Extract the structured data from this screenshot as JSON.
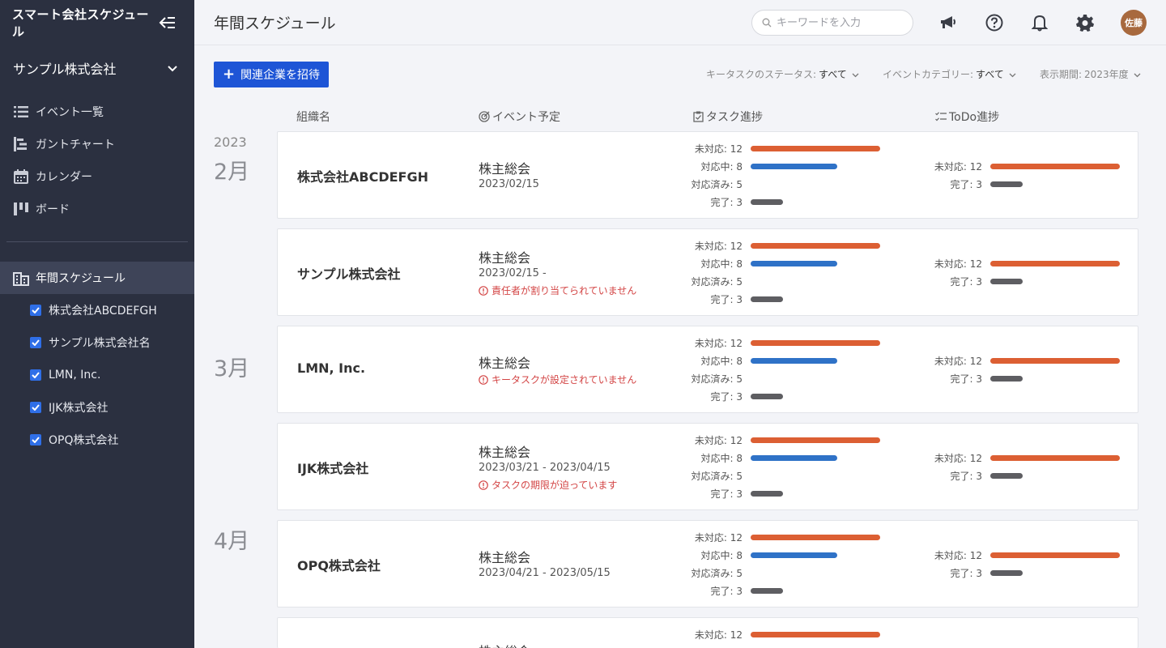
{
  "app": {
    "brand": "スマート会社スケジュール"
  },
  "sidebar": {
    "org_selector": "サンプル株式会社",
    "nav": [
      {
        "label": "イベント一覧",
        "icon": "list-icon"
      },
      {
        "label": "ガントチャート",
        "icon": "gantt-icon"
      },
      {
        "label": "カレンダー",
        "icon": "calendar-icon"
      },
      {
        "label": "ボード",
        "icon": "board-icon"
      }
    ],
    "active_section": {
      "label": "年間スケジュール",
      "icon": "building-icon"
    },
    "orgs": [
      {
        "label": "株式会社ABCDEFGH",
        "checked": true
      },
      {
        "label": "サンプル株式会社名",
        "checked": true
      },
      {
        "label": "LMN, Inc.",
        "checked": true
      },
      {
        "label": "IJK株式会社",
        "checked": true
      },
      {
        "label": "OPQ株式会社",
        "checked": true
      }
    ]
  },
  "header": {
    "title": "年間スケジュール",
    "search_placeholder": "キーワードを入力",
    "avatar": "佐藤"
  },
  "toolbar": {
    "invite_label": "関連企業を招待",
    "filters": [
      {
        "label": "キータスクのステータス:",
        "value": "すべて"
      },
      {
        "label": "イベントカテゴリー:",
        "value": "すべて"
      },
      {
        "label": "表示期間:",
        "value": "2023年度"
      }
    ]
  },
  "columns": {
    "org": "組織名",
    "event": "イベント予定",
    "task": "タスク進捗",
    "todo": "ToDo進捗"
  },
  "timeline": {
    "year": "2023",
    "months": [
      "2月",
      "3月",
      "4月"
    ]
  },
  "colors": {
    "orange": "#dc5f33",
    "blue": "#2f72c7",
    "gray": "#5e5e62",
    "accent": "#1e55d6",
    "sidebar": "#2b3040"
  },
  "stat_max": 12,
  "rows": [
    {
      "org": "株式会社ABCDEFGH",
      "event": "株主総会",
      "date": "2023/02/15",
      "warning": "",
      "task": [
        {
          "label": "未対応: 12",
          "value": 12,
          "color": "orange"
        },
        {
          "label": "対応中: 8",
          "value": 8,
          "color": "blue"
        },
        {
          "label": "対応済み: 5",
          "value": 5,
          "color": "none"
        },
        {
          "label": "完了: 3",
          "value": 3,
          "color": "gray"
        }
      ],
      "todo": [
        {
          "label": "未対応: 12",
          "value": 12,
          "color": "orange"
        },
        {
          "label": "完了: 3",
          "value": 3,
          "color": "gray"
        }
      ]
    },
    {
      "org": "サンプル株式会社",
      "event": "株主総会",
      "date": "2023/02/15 -",
      "warning": "責任者が割り当てられていません",
      "task": [
        {
          "label": "未対応: 12",
          "value": 12,
          "color": "orange"
        },
        {
          "label": "対応中: 8",
          "value": 8,
          "color": "blue"
        },
        {
          "label": "対応済み: 5",
          "value": 5,
          "color": "none"
        },
        {
          "label": "完了: 3",
          "value": 3,
          "color": "gray"
        }
      ],
      "todo": [
        {
          "label": "未対応: 12",
          "value": 12,
          "color": "orange"
        },
        {
          "label": "完了: 3",
          "value": 3,
          "color": "gray"
        }
      ]
    },
    {
      "org": "LMN, Inc.",
      "event": "株主総会",
      "date": "",
      "warning": "キータスクが設定されていません",
      "task": [
        {
          "label": "未対応: 12",
          "value": 12,
          "color": "orange"
        },
        {
          "label": "対応中: 8",
          "value": 8,
          "color": "blue"
        },
        {
          "label": "対応済み: 5",
          "value": 5,
          "color": "none"
        },
        {
          "label": "完了: 3",
          "value": 3,
          "color": "gray"
        }
      ],
      "todo": [
        {
          "label": "未対応: 12",
          "value": 12,
          "color": "orange"
        },
        {
          "label": "完了: 3",
          "value": 3,
          "color": "gray"
        }
      ]
    },
    {
      "org": "IJK株式会社",
      "event": "株主総会",
      "date": "2023/03/21 - 2023/04/15",
      "warning": "タスクの期限が迫っています",
      "task": [
        {
          "label": "未対応: 12",
          "value": 12,
          "color": "orange"
        },
        {
          "label": "対応中: 8",
          "value": 8,
          "color": "blue"
        },
        {
          "label": "対応済み: 5",
          "value": 5,
          "color": "none"
        },
        {
          "label": "完了: 3",
          "value": 3,
          "color": "gray"
        }
      ],
      "todo": [
        {
          "label": "未対応: 12",
          "value": 12,
          "color": "orange"
        },
        {
          "label": "完了: 3",
          "value": 3,
          "color": "gray"
        }
      ]
    },
    {
      "org": "OPQ株式会社",
      "event": "株主総会",
      "date": "2023/04/21 - 2023/05/15",
      "warning": "",
      "task": [
        {
          "label": "未対応: 12",
          "value": 12,
          "color": "orange"
        },
        {
          "label": "対応中: 8",
          "value": 8,
          "color": "blue"
        },
        {
          "label": "対応済み: 5",
          "value": 5,
          "color": "none"
        },
        {
          "label": "完了: 3",
          "value": 3,
          "color": "gray"
        }
      ],
      "todo": [
        {
          "label": "未対応: 12",
          "value": 12,
          "color": "orange"
        },
        {
          "label": "完了: 3",
          "value": 3,
          "color": "gray"
        }
      ]
    },
    {
      "org": "",
      "event": "株主総会",
      "date": "",
      "warning": "",
      "task": [
        {
          "label": "未対応: 12",
          "value": 12,
          "color": "orange"
        }
      ],
      "todo": []
    }
  ]
}
